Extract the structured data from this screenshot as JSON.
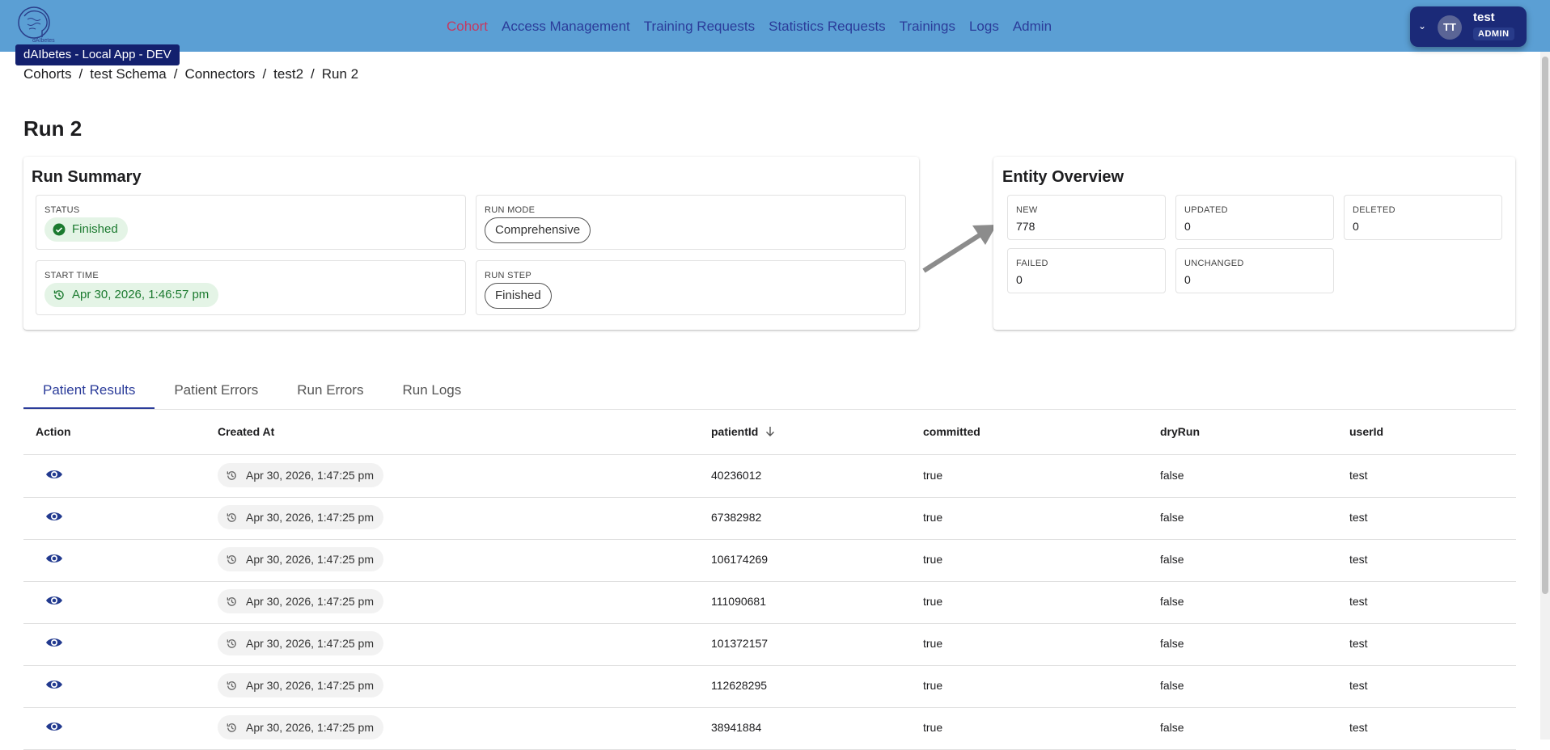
{
  "app": {
    "env_badge": "dAIbetes - Local App - DEV",
    "logo_text": "dAIbetes"
  },
  "nav": {
    "items": [
      {
        "label": "Cohort",
        "active": true
      },
      {
        "label": "Access Management"
      },
      {
        "label": "Training Requests"
      },
      {
        "label": "Statistics Requests"
      },
      {
        "label": "Trainings"
      },
      {
        "label": "Logs"
      },
      {
        "label": "Admin"
      }
    ]
  },
  "user": {
    "initials": "TT",
    "name": "test",
    "role": "ADMIN"
  },
  "breadcrumb": [
    "Cohorts",
    "test Schema",
    "Connectors",
    "test2",
    "Run 2"
  ],
  "page_title": "Run 2",
  "run_summary": {
    "title": "Run Summary",
    "status_label": "STATUS",
    "status_value": "Finished",
    "run_mode_label": "RUN MODE",
    "run_mode_value": "Comprehensive",
    "start_time_label": "START TIME",
    "start_time_value": "Apr 30, 2026, 1:46:57 pm",
    "run_step_label": "RUN STEP",
    "run_step_value": "Finished"
  },
  "entity_overview": {
    "title": "Entity Overview",
    "new_label": "NEW",
    "new_value": "778",
    "updated_label": "UPDATED",
    "updated_value": "0",
    "deleted_label": "DELETED",
    "deleted_value": "0",
    "failed_label": "FAILED",
    "failed_value": "0",
    "unchanged_label": "UNCHANGED",
    "unchanged_value": "0"
  },
  "tabs": [
    "Patient Results",
    "Patient Errors",
    "Run Errors",
    "Run Logs"
  ],
  "table": {
    "headers": {
      "action": "Action",
      "created_at": "Created At",
      "patient_id": "patientId",
      "committed": "committed",
      "dry_run": "dryRun",
      "user_id": "userId"
    },
    "rows": [
      {
        "created_at": "Apr 30, 2026, 1:47:25 pm",
        "patient_id": "40236012",
        "committed": "true",
        "dry_run": "false",
        "user_id": "test"
      },
      {
        "created_at": "Apr 30, 2026, 1:47:25 pm",
        "patient_id": "67382982",
        "committed": "true",
        "dry_run": "false",
        "user_id": "test"
      },
      {
        "created_at": "Apr 30, 2026, 1:47:25 pm",
        "patient_id": "106174269",
        "committed": "true",
        "dry_run": "false",
        "user_id": "test"
      },
      {
        "created_at": "Apr 30, 2026, 1:47:25 pm",
        "patient_id": "111090681",
        "committed": "true",
        "dry_run": "false",
        "user_id": "test"
      },
      {
        "created_at": "Apr 30, 2026, 1:47:25 pm",
        "patient_id": "101372157",
        "committed": "true",
        "dry_run": "false",
        "user_id": "test"
      },
      {
        "created_at": "Apr 30, 2026, 1:47:25 pm",
        "patient_id": "112628295",
        "committed": "true",
        "dry_run": "false",
        "user_id": "test"
      },
      {
        "created_at": "Apr 30, 2026, 1:47:25 pm",
        "patient_id": "38941884",
        "committed": "true",
        "dry_run": "false",
        "user_id": "test"
      }
    ]
  },
  "colors": {
    "topbar": "#5b9fd4",
    "nav_link": "#2b3c9a",
    "nav_active": "#c43a62",
    "success": "#1b7a2f"
  },
  "icons": {
    "view": "eye-icon",
    "history": "history-icon",
    "status": "check-circle-icon",
    "sort": "arrow-down-icon",
    "user_menu": "chevron-down-icon"
  }
}
